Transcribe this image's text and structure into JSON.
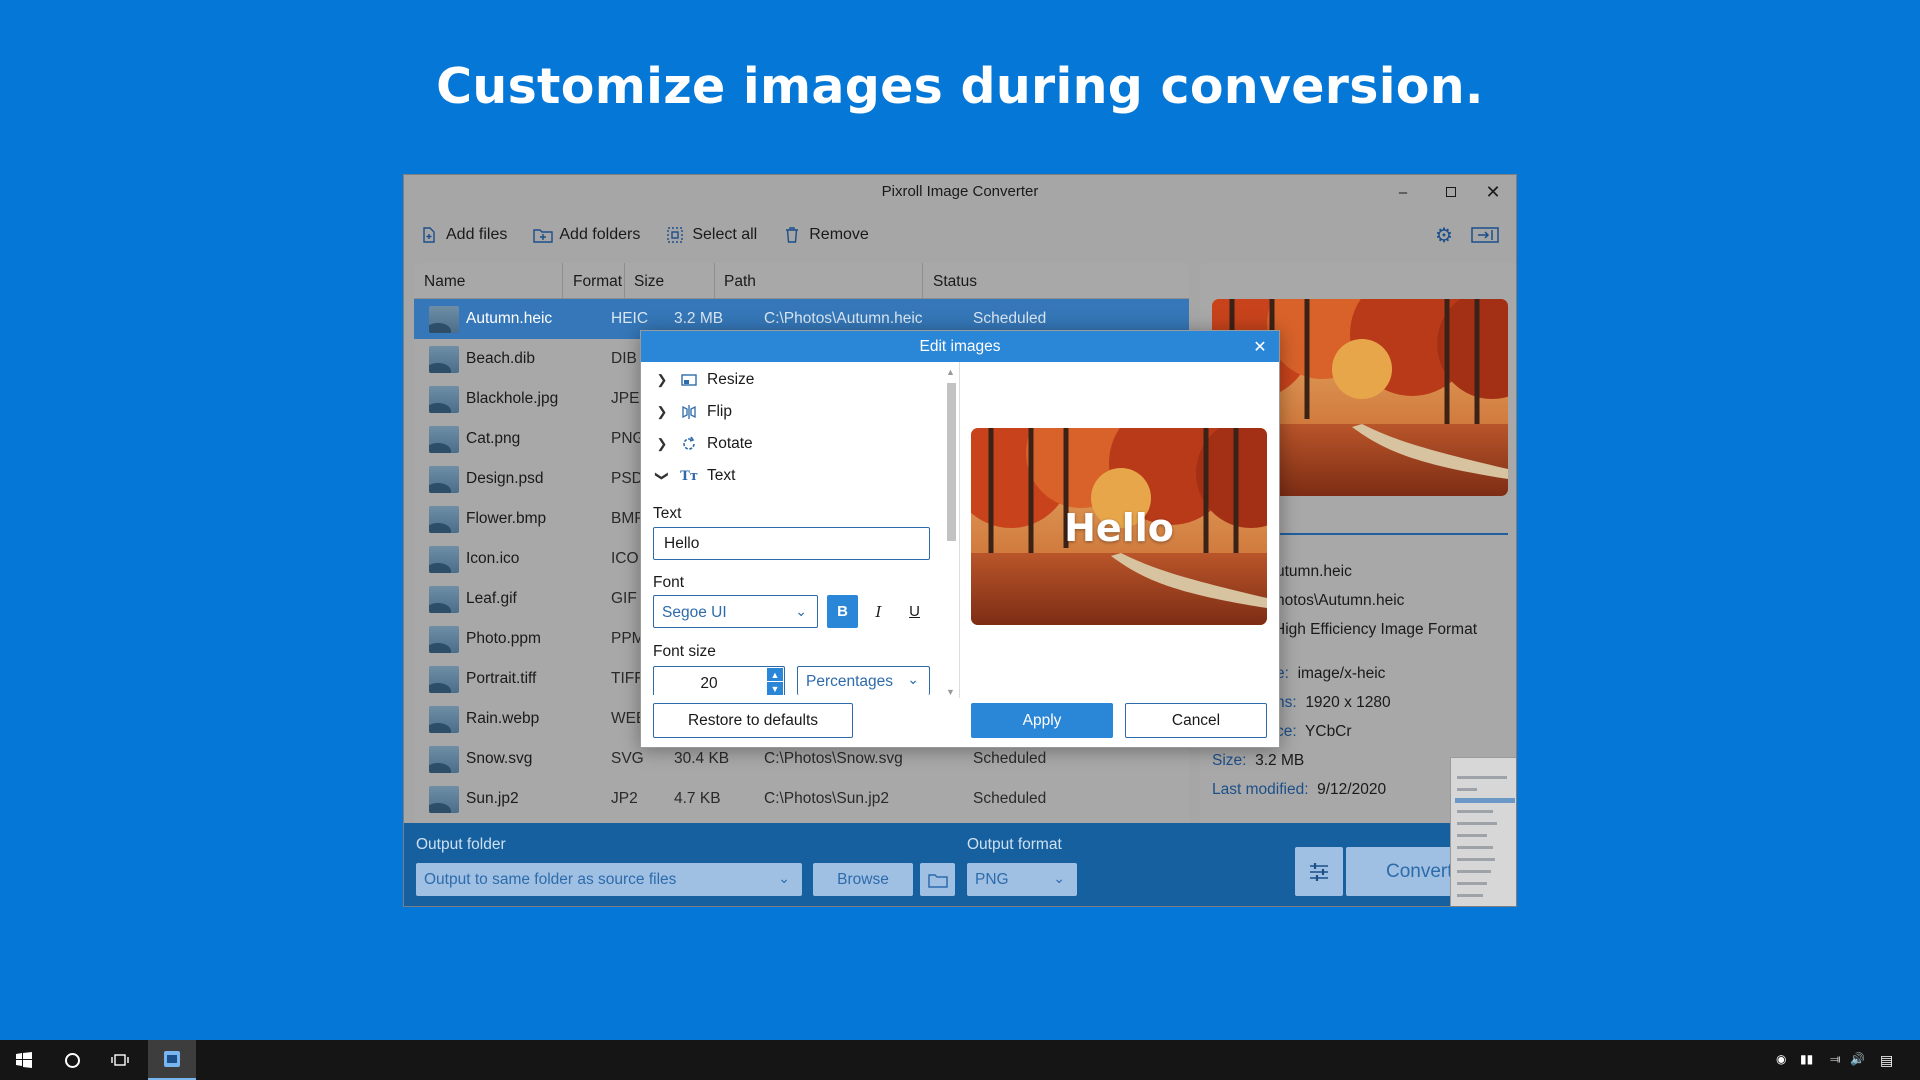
{
  "headline": "Customize images during conversion.",
  "window": {
    "title": "Pixroll Image Converter",
    "controls": [
      "minimize-icon",
      "maximize-icon",
      "close-icon"
    ]
  },
  "toolbar": {
    "add_files": "Add files",
    "add_folders": "Add folders",
    "select_all": "Select all",
    "remove": "Remove",
    "right_icons": [
      "gear-icon",
      "panel-toggle-icon"
    ]
  },
  "table": {
    "headers": [
      "Name",
      "Format",
      "Size",
      "Path",
      "Status"
    ],
    "rows": [
      {
        "name": "Autumn.heic",
        "format": "HEIC",
        "size": "3.2 MB",
        "path": "C:\\Photos\\Autumn.heic",
        "status": "Scheduled",
        "selected": true
      },
      {
        "name": "Beach.dib",
        "format": "DIB",
        "size": "",
        "path": "",
        "status": ""
      },
      {
        "name": "Blackhole.jpg",
        "format": "JPEG",
        "size": "",
        "path": "",
        "status": ""
      },
      {
        "name": "Cat.png",
        "format": "PNG",
        "size": "",
        "path": "",
        "status": ""
      },
      {
        "name": "Design.psd",
        "format": "PSD",
        "size": "",
        "path": "",
        "status": ""
      },
      {
        "name": "Flower.bmp",
        "format": "BMP",
        "size": "",
        "path": "",
        "status": ""
      },
      {
        "name": "Icon.ico",
        "format": "ICO",
        "size": "",
        "path": "",
        "status": ""
      },
      {
        "name": "Leaf.gif",
        "format": "GIF",
        "size": "",
        "path": "",
        "status": ""
      },
      {
        "name": "Photo.ppm",
        "format": "PPM",
        "size": "",
        "path": "",
        "status": ""
      },
      {
        "name": "Portrait.tiff",
        "format": "TIFF",
        "size": "",
        "path": "",
        "status": ""
      },
      {
        "name": "Rain.webp",
        "format": "WEB",
        "size": "",
        "path": "",
        "status": ""
      },
      {
        "name": "Snow.svg",
        "format": "SVG",
        "size": "30.4 KB",
        "path": "C:\\Photos\\Snow.svg",
        "status": "Scheduled"
      },
      {
        "name": "Sun.jp2",
        "format": "JP2",
        "size": "4.7 KB",
        "path": "C:\\Photos\\Sun.jp2",
        "status": "Scheduled"
      }
    ]
  },
  "details": {
    "name_partial": "utumn.heic",
    "path_partial": "hotos\\Autumn.heic",
    "format_partial": "High Efficiency Image Format",
    "mime_key_partial": "e:",
    "mime": "image/x-heic",
    "dims_key_partial": "ns:",
    "dims": "1920 x 1280",
    "space_key_partial": "ce:",
    "space": "YCbCr",
    "size_key": "Size:",
    "size": "3.2 MB",
    "modified_key": "Last modified:",
    "modified": "9/12/2020"
  },
  "bottom": {
    "output_folder_label": "Output folder",
    "output_folder_value": "Output to same folder as source files",
    "browse": "Browse",
    "output_format_label": "Output format",
    "output_format_value": "PNG",
    "convert": "Convert"
  },
  "dialog": {
    "title": "Edit images",
    "tree": [
      "Resize",
      "Flip",
      "Rotate",
      "Text"
    ],
    "text_label": "Text",
    "text_value": "Hello",
    "font_label": "Font",
    "font_value": "Segoe UI",
    "bold": "B",
    "italic": "I",
    "underline": "U",
    "font_size_label": "Font size",
    "font_size_value": "20",
    "units_value": "Percentages",
    "preview_text": "Hello",
    "restore": "Restore to defaults",
    "apply": "Apply",
    "cancel": "Cancel"
  }
}
